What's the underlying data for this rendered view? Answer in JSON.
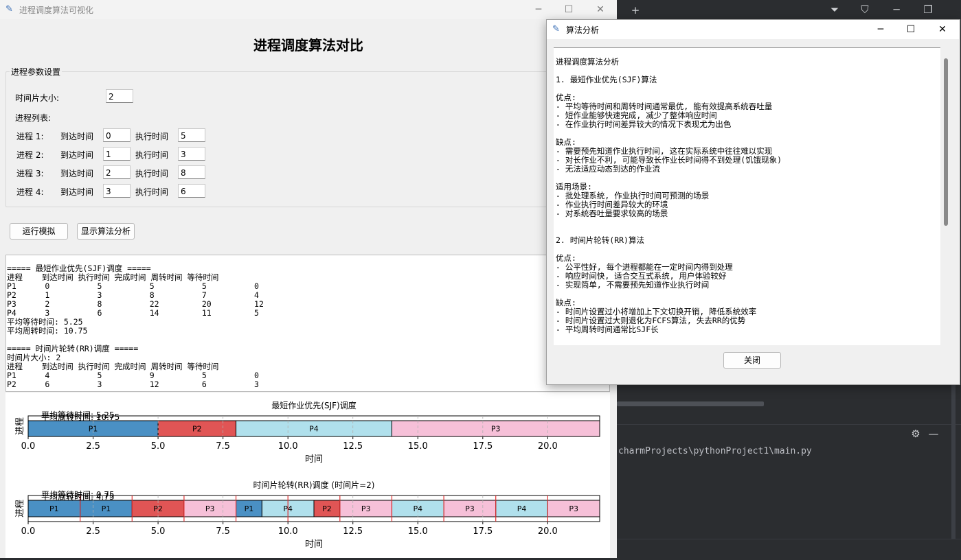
{
  "main_window": {
    "title": "进程调度算法可视化",
    "heading": "进程调度算法对比",
    "params_group": "进程参数设置",
    "time_slice_label": "时间片大小:",
    "time_slice_value": "2",
    "process_list_label": "进程列表:",
    "arrival_label": "到达时间",
    "exec_label": "执行时间",
    "processes": [
      {
        "label": "进程 1:",
        "arrival": "0",
        "exec": "5"
      },
      {
        "label": "进程 2:",
        "arrival": "1",
        "exec": "3"
      },
      {
        "label": "进程 3:",
        "arrival": "2",
        "exec": "8"
      },
      {
        "label": "进程 4:",
        "arrival": "3",
        "exec": "6"
      }
    ],
    "run_button": "运行模拟",
    "analysis_button": "显示算法分析",
    "output_lines": [
      "===== 最短作业优先(SJF)调度 =====",
      "进程    到达时间 执行时间 完成时间 周转时间 等待时间",
      "P1      0          5          5          5          0",
      "P2      1          3          8          7          4",
      "P3      2          8          22         20         12",
      "P4      3          6          14         11         5",
      "平均等待时间: 5.25",
      "平均周转时间: 10.75",
      "",
      "===== 时间片轮转(RR)调度 =====",
      "时间片大小: 2",
      "进程    到达时间 执行时间 完成时间 周转时间 等待时间",
      "P1      4          5          9          5          0",
      "P2      6          3          12         6          3"
    ]
  },
  "chart_data": [
    {
      "type": "gantt",
      "title": "最短作业优先(SJF)调度",
      "xlabel": "时间",
      "ylabel": "进程",
      "xlim": [
        0,
        22
      ],
      "xticks": [
        "0.0",
        "2.5",
        "5.0",
        "7.5",
        "10.0",
        "12.5",
        "15.0",
        "17.5",
        "20.0"
      ],
      "annotations": [
        "平均等待时间: 5.25",
        "平均周转时间: 10.75"
      ],
      "segments": [
        {
          "name": "P1",
          "start": 0,
          "end": 5,
          "color": "#4a90c4"
        },
        {
          "name": "P2",
          "start": 5,
          "end": 8,
          "color": "#e05555"
        },
        {
          "name": "P4",
          "start": 8,
          "end": 14,
          "color": "#b0e0ec"
        },
        {
          "name": "P3",
          "start": 14,
          "end": 22,
          "color": "#f6c0d8"
        }
      ],
      "grid": true
    },
    {
      "type": "gantt",
      "title": "时间片轮转(RR)调度 (时间片=2)",
      "xlabel": "时间",
      "ylabel": "进程",
      "xlim": [
        0,
        22
      ],
      "xticks": [
        "0.0",
        "2.5",
        "5.0",
        "7.5",
        "10.0",
        "12.5",
        "15.0",
        "17.5",
        "20.0"
      ],
      "annotations": [
        "平均等待时间: 0.75",
        "平均周转时间: 4.75"
      ],
      "segments": [
        {
          "name": "P1",
          "start": 0,
          "end": 2,
          "color": "#4a90c4"
        },
        {
          "name": "P1",
          "start": 2,
          "end": 4,
          "color": "#4a90c4"
        },
        {
          "name": "P2",
          "start": 4,
          "end": 6,
          "color": "#e05555"
        },
        {
          "name": "P3",
          "start": 6,
          "end": 8,
          "color": "#f6c0d8"
        },
        {
          "name": "P1",
          "start": 8,
          "end": 9,
          "color": "#4a90c4"
        },
        {
          "name": "P4",
          "start": 9,
          "end": 11,
          "color": "#b0e0ec"
        },
        {
          "name": "P2",
          "start": 11,
          "end": 12,
          "color": "#e05555"
        },
        {
          "name": "P3",
          "start": 12,
          "end": 14,
          "color": "#f6c0d8"
        },
        {
          "name": "P4",
          "start": 14,
          "end": 16,
          "color": "#b0e0ec"
        },
        {
          "name": "P3",
          "start": 16,
          "end": 18,
          "color": "#f6c0d8"
        },
        {
          "name": "P4",
          "start": 18,
          "end": 20,
          "color": "#b0e0ec"
        },
        {
          "name": "P3",
          "start": 20,
          "end": 22,
          "color": "#f6c0d8"
        }
      ],
      "slice_lines": [
        2,
        4,
        6,
        8,
        10,
        12,
        14,
        16,
        18,
        20
      ],
      "grid": true
    }
  ],
  "dialog": {
    "title": "算法分析",
    "close_button": "关闭",
    "lines": [
      "进程调度算法分析",
      "",
      "1. 最短作业优先(SJF)算法",
      "",
      "优点:",
      "- 平均等待时间和周转时间通常最优, 能有效提高系统吞吐量",
      "- 短作业能够快速完成, 减少了整体响应时间",
      "- 在作业执行时间差异较大的情况下表现尤为出色",
      "",
      "缺点:",
      "- 需要预先知道作业执行时间, 这在实际系统中往往难以实现",
      "- 对长作业不利, 可能导致长作业长时间得不到处理(饥饿现象)",
      "- 无法适应动态到达的作业流",
      "",
      "适用场景:",
      "- 批处理系统, 作业执行时间可预测的场景",
      "- 作业执行时间差异较大的环境",
      "- 对系统吞吐量要求较高的场景",
      "",
      "",
      "2. 时间片轮转(RR)算法",
      "",
      "优点:",
      "- 公平性好, 每个进程都能在一定时间内得到处理",
      "- 响应时间快, 适合交互式系统, 用户体验较好",
      "- 实现简单, 不需要预先知道作业执行时间",
      "",
      "缺点:",
      "- 时间片设置过小将增加上下文切换开销, 降低系统效率",
      "- 时间片设置过大则退化为FCFS算法, 失去RR的优势",
      "- 平均周转时间通常比SJF长"
    ]
  },
  "ide": {
    "path_text": "charmProjects\\pythonProject1\\main.py",
    "new_tab": "+"
  }
}
